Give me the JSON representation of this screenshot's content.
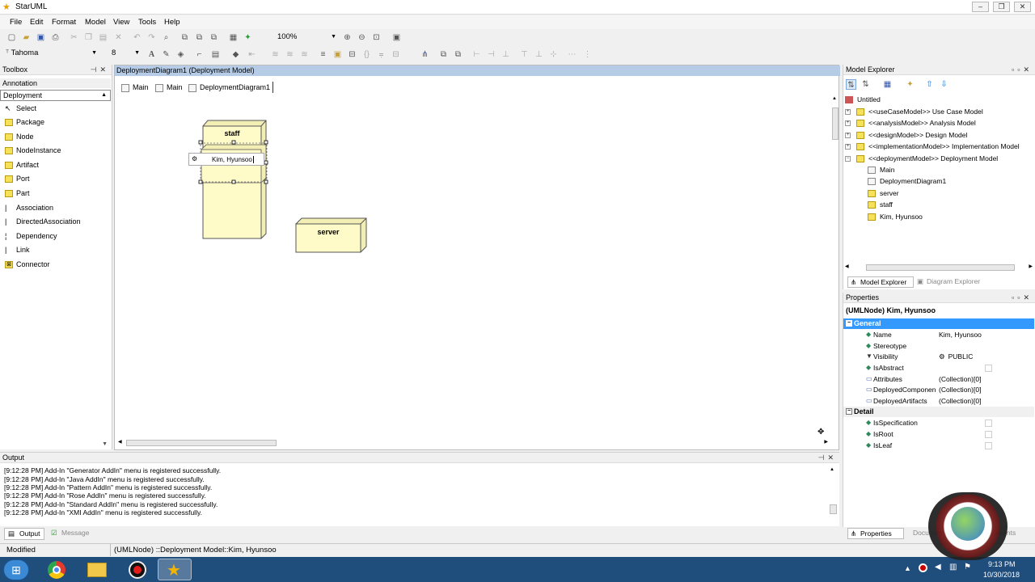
{
  "window": {
    "title": "StarUML"
  },
  "menu": [
    "File",
    "Edit",
    "Format",
    "Model",
    "View",
    "Tools",
    "Help"
  ],
  "toolbar": {
    "zoom": "100%",
    "font_name": "Tahoma",
    "font_size": "8"
  },
  "toolbox": {
    "title": "Toolbox",
    "sections": [
      "Annotation",
      "Deployment"
    ],
    "items": [
      "Select",
      "Package",
      "Node",
      "NodeInstance",
      "Artifact",
      "Port",
      "Part",
      "Association",
      "DirectedAssociation",
      "Dependency",
      "Link",
      "Connector"
    ]
  },
  "diagram": {
    "title": "DeploymentDiagram1 (Deployment Model)",
    "tabs": [
      "Main",
      "Main",
      "DeploymentDiagram1"
    ],
    "nodes": [
      {
        "name": "staff"
      },
      {
        "name": "server"
      }
    ],
    "editing_value": "Kim, Hyunsoo"
  },
  "model_explorer": {
    "title": "Model Explorer",
    "root": "Untitled",
    "items": [
      "<<useCaseModel>> Use Case Model",
      "<<analysisModel>> Analysis Model",
      "<<designModel>> Design Model",
      "<<implementationModel>> Implementation Model",
      "<<deploymentModel>> Deployment Model"
    ],
    "children": [
      "Main",
      "DeploymentDiagram1",
      "server",
      "staff",
      "Kim, Hyunsoo"
    ],
    "tabs": [
      "Model Explorer",
      "Diagram Explorer"
    ]
  },
  "properties": {
    "title": "Properties",
    "selected": "(UMLNode) Kim, Hyunsoo",
    "general_label": "General",
    "general": [
      {
        "key": "Name",
        "value": "Kim, Hyunsoo"
      },
      {
        "key": "Stereotype",
        "value": ""
      },
      {
        "key": "Visibility",
        "value": "PUBLIC"
      },
      {
        "key": "IsAbstract",
        "value": ""
      },
      {
        "key": "Attributes",
        "value": "(Collection)[0]"
      },
      {
        "key": "DeployedComponen",
        "value": "(Collection)[0]"
      },
      {
        "key": "DeployedArtifacts",
        "value": "(Collection)[0]"
      }
    ],
    "detail_label": "Detail",
    "detail": [
      "IsSpecification",
      "IsRoot",
      "IsLeaf"
    ],
    "tabs": [
      "Properties",
      "Documentation",
      "Attachments"
    ]
  },
  "output": {
    "title": "Output",
    "lines": [
      "[9:12:28 PM]  Add-In \"Generator AddIn\" menu is registered successfully.",
      "[9:12:28 PM]  Add-In \"Java AddIn\" menu is registered successfully.",
      "[9:12:28 PM]  Add-In \"Pattern AddIn\" menu is registered successfully.",
      "[9:12:28 PM]  Add-In \"Rose AddIn\" menu is registered successfully.",
      "[9:12:28 PM]  Add-In \"Standard AddIn\" menu is registered successfully.",
      "[9:12:28 PM]  Add-In \"XMI AddIn\" menu is registered successfully."
    ],
    "tabs": [
      "Output",
      "Message"
    ]
  },
  "status": {
    "state": "Modified",
    "path": "(UMLNode) ::Deployment Model::Kim, Hyunsoo"
  },
  "taskbar": {
    "time": "9:13 PM",
    "date": "10/30/2018"
  }
}
